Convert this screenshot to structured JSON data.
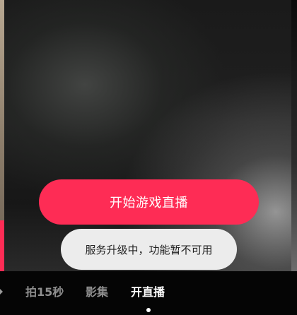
{
  "live": {
    "start_button_label": "开始游戏直播"
  },
  "toast": {
    "message": "服务升级中，功能暂不可用"
  },
  "mode_tabs": [
    {
      "label": "拍15秒",
      "active": false
    },
    {
      "label": "影集",
      "active": false
    },
    {
      "label": "开直播",
      "active": true
    }
  ],
  "colors": {
    "accent": "#fe2c55",
    "toast_background": "#ececec",
    "active_tab": "#ffffff",
    "inactive_tab": "#8f8f8f"
  }
}
